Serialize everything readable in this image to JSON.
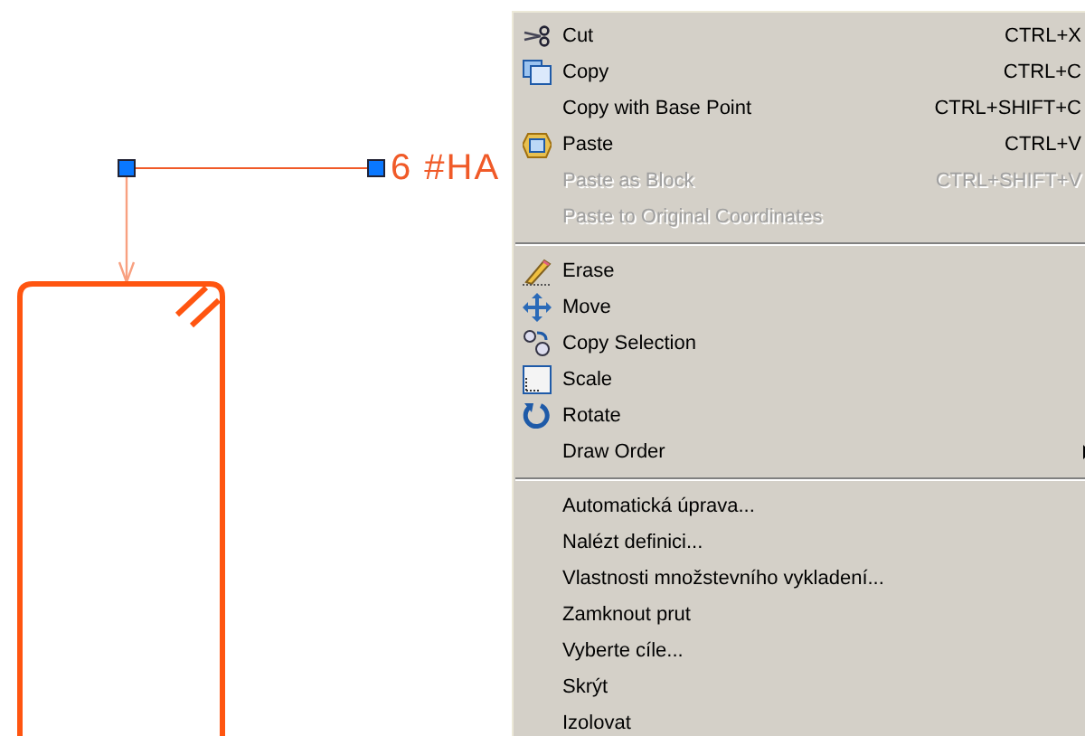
{
  "drawing": {
    "label": "6 #HA"
  },
  "context_menu": {
    "items": [
      {
        "kind": "command",
        "label": "Cut",
        "shortcut": "CTRL+X",
        "disabled": false
      },
      {
        "kind": "command",
        "label": "Copy",
        "shortcut": "CTRL+C",
        "disabled": false
      },
      {
        "kind": "command",
        "label": "Copy with Base Point",
        "shortcut": "CTRL+SHIFT+C",
        "disabled": false
      },
      {
        "kind": "command",
        "label": "Paste",
        "shortcut": "CTRL+V",
        "disabled": false
      },
      {
        "kind": "command",
        "label": "Paste as Block",
        "shortcut": "CTRL+SHIFT+V",
        "disabled": true
      },
      {
        "kind": "command",
        "label": "Paste to Original Coordinates",
        "disabled": true
      },
      {
        "kind": "separator"
      },
      {
        "kind": "command",
        "label": "Erase",
        "disabled": false
      },
      {
        "kind": "command",
        "label": "Move",
        "disabled": false
      },
      {
        "kind": "command",
        "label": "Copy Selection",
        "disabled": false
      },
      {
        "kind": "command",
        "label": "Scale",
        "disabled": false
      },
      {
        "kind": "command",
        "label": "Rotate",
        "disabled": false
      },
      {
        "kind": "submenu",
        "label": "Draw Order",
        "disabled": false
      },
      {
        "kind": "separator"
      },
      {
        "kind": "command",
        "label": "Automatická úprava...",
        "disabled": false
      },
      {
        "kind": "command",
        "label": "Nalézt definici...",
        "disabled": false
      },
      {
        "kind": "command",
        "label": "Vlastnosti množstevního vykladení...",
        "disabled": false
      },
      {
        "kind": "command",
        "label": "Zamknout prut",
        "disabled": false
      },
      {
        "kind": "command",
        "label": "Vyberte cíle...",
        "disabled": false
      },
      {
        "kind": "command",
        "label": "Skrýt",
        "disabled": false
      },
      {
        "kind": "command",
        "label": "Izolovat",
        "disabled": false
      }
    ]
  }
}
